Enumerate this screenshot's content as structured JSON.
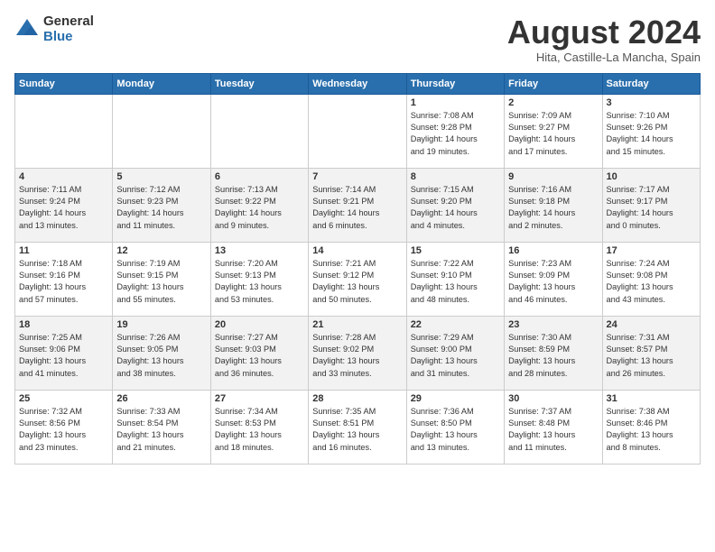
{
  "header": {
    "logo_general": "General",
    "logo_blue": "Blue",
    "month_title": "August 2024",
    "location": "Hita, Castille-La Mancha, Spain"
  },
  "days_of_week": [
    "Sunday",
    "Monday",
    "Tuesday",
    "Wednesday",
    "Thursday",
    "Friday",
    "Saturday"
  ],
  "weeks": [
    [
      {
        "day": "",
        "detail": ""
      },
      {
        "day": "",
        "detail": ""
      },
      {
        "day": "",
        "detail": ""
      },
      {
        "day": "",
        "detail": ""
      },
      {
        "day": "1",
        "detail": "Sunrise: 7:08 AM\nSunset: 9:28 PM\nDaylight: 14 hours\nand 19 minutes."
      },
      {
        "day": "2",
        "detail": "Sunrise: 7:09 AM\nSunset: 9:27 PM\nDaylight: 14 hours\nand 17 minutes."
      },
      {
        "day": "3",
        "detail": "Sunrise: 7:10 AM\nSunset: 9:26 PM\nDaylight: 14 hours\nand 15 minutes."
      }
    ],
    [
      {
        "day": "4",
        "detail": "Sunrise: 7:11 AM\nSunset: 9:24 PM\nDaylight: 14 hours\nand 13 minutes."
      },
      {
        "day": "5",
        "detail": "Sunrise: 7:12 AM\nSunset: 9:23 PM\nDaylight: 14 hours\nand 11 minutes."
      },
      {
        "day": "6",
        "detail": "Sunrise: 7:13 AM\nSunset: 9:22 PM\nDaylight: 14 hours\nand 9 minutes."
      },
      {
        "day": "7",
        "detail": "Sunrise: 7:14 AM\nSunset: 9:21 PM\nDaylight: 14 hours\nand 6 minutes."
      },
      {
        "day": "8",
        "detail": "Sunrise: 7:15 AM\nSunset: 9:20 PM\nDaylight: 14 hours\nand 4 minutes."
      },
      {
        "day": "9",
        "detail": "Sunrise: 7:16 AM\nSunset: 9:18 PM\nDaylight: 14 hours\nand 2 minutes."
      },
      {
        "day": "10",
        "detail": "Sunrise: 7:17 AM\nSunset: 9:17 PM\nDaylight: 14 hours\nand 0 minutes."
      }
    ],
    [
      {
        "day": "11",
        "detail": "Sunrise: 7:18 AM\nSunset: 9:16 PM\nDaylight: 13 hours\nand 57 minutes."
      },
      {
        "day": "12",
        "detail": "Sunrise: 7:19 AM\nSunset: 9:15 PM\nDaylight: 13 hours\nand 55 minutes."
      },
      {
        "day": "13",
        "detail": "Sunrise: 7:20 AM\nSunset: 9:13 PM\nDaylight: 13 hours\nand 53 minutes."
      },
      {
        "day": "14",
        "detail": "Sunrise: 7:21 AM\nSunset: 9:12 PM\nDaylight: 13 hours\nand 50 minutes."
      },
      {
        "day": "15",
        "detail": "Sunrise: 7:22 AM\nSunset: 9:10 PM\nDaylight: 13 hours\nand 48 minutes."
      },
      {
        "day": "16",
        "detail": "Sunrise: 7:23 AM\nSunset: 9:09 PM\nDaylight: 13 hours\nand 46 minutes."
      },
      {
        "day": "17",
        "detail": "Sunrise: 7:24 AM\nSunset: 9:08 PM\nDaylight: 13 hours\nand 43 minutes."
      }
    ],
    [
      {
        "day": "18",
        "detail": "Sunrise: 7:25 AM\nSunset: 9:06 PM\nDaylight: 13 hours\nand 41 minutes."
      },
      {
        "day": "19",
        "detail": "Sunrise: 7:26 AM\nSunset: 9:05 PM\nDaylight: 13 hours\nand 38 minutes."
      },
      {
        "day": "20",
        "detail": "Sunrise: 7:27 AM\nSunset: 9:03 PM\nDaylight: 13 hours\nand 36 minutes."
      },
      {
        "day": "21",
        "detail": "Sunrise: 7:28 AM\nSunset: 9:02 PM\nDaylight: 13 hours\nand 33 minutes."
      },
      {
        "day": "22",
        "detail": "Sunrise: 7:29 AM\nSunset: 9:00 PM\nDaylight: 13 hours\nand 31 minutes."
      },
      {
        "day": "23",
        "detail": "Sunrise: 7:30 AM\nSunset: 8:59 PM\nDaylight: 13 hours\nand 28 minutes."
      },
      {
        "day": "24",
        "detail": "Sunrise: 7:31 AM\nSunset: 8:57 PM\nDaylight: 13 hours\nand 26 minutes."
      }
    ],
    [
      {
        "day": "25",
        "detail": "Sunrise: 7:32 AM\nSunset: 8:56 PM\nDaylight: 13 hours\nand 23 minutes."
      },
      {
        "day": "26",
        "detail": "Sunrise: 7:33 AM\nSunset: 8:54 PM\nDaylight: 13 hours\nand 21 minutes."
      },
      {
        "day": "27",
        "detail": "Sunrise: 7:34 AM\nSunset: 8:53 PM\nDaylight: 13 hours\nand 18 minutes."
      },
      {
        "day": "28",
        "detail": "Sunrise: 7:35 AM\nSunset: 8:51 PM\nDaylight: 13 hours\nand 16 minutes."
      },
      {
        "day": "29",
        "detail": "Sunrise: 7:36 AM\nSunset: 8:50 PM\nDaylight: 13 hours\nand 13 minutes."
      },
      {
        "day": "30",
        "detail": "Sunrise: 7:37 AM\nSunset: 8:48 PM\nDaylight: 13 hours\nand 11 minutes."
      },
      {
        "day": "31",
        "detail": "Sunrise: 7:38 AM\nSunset: 8:46 PM\nDaylight: 13 hours\nand 8 minutes."
      }
    ]
  ]
}
